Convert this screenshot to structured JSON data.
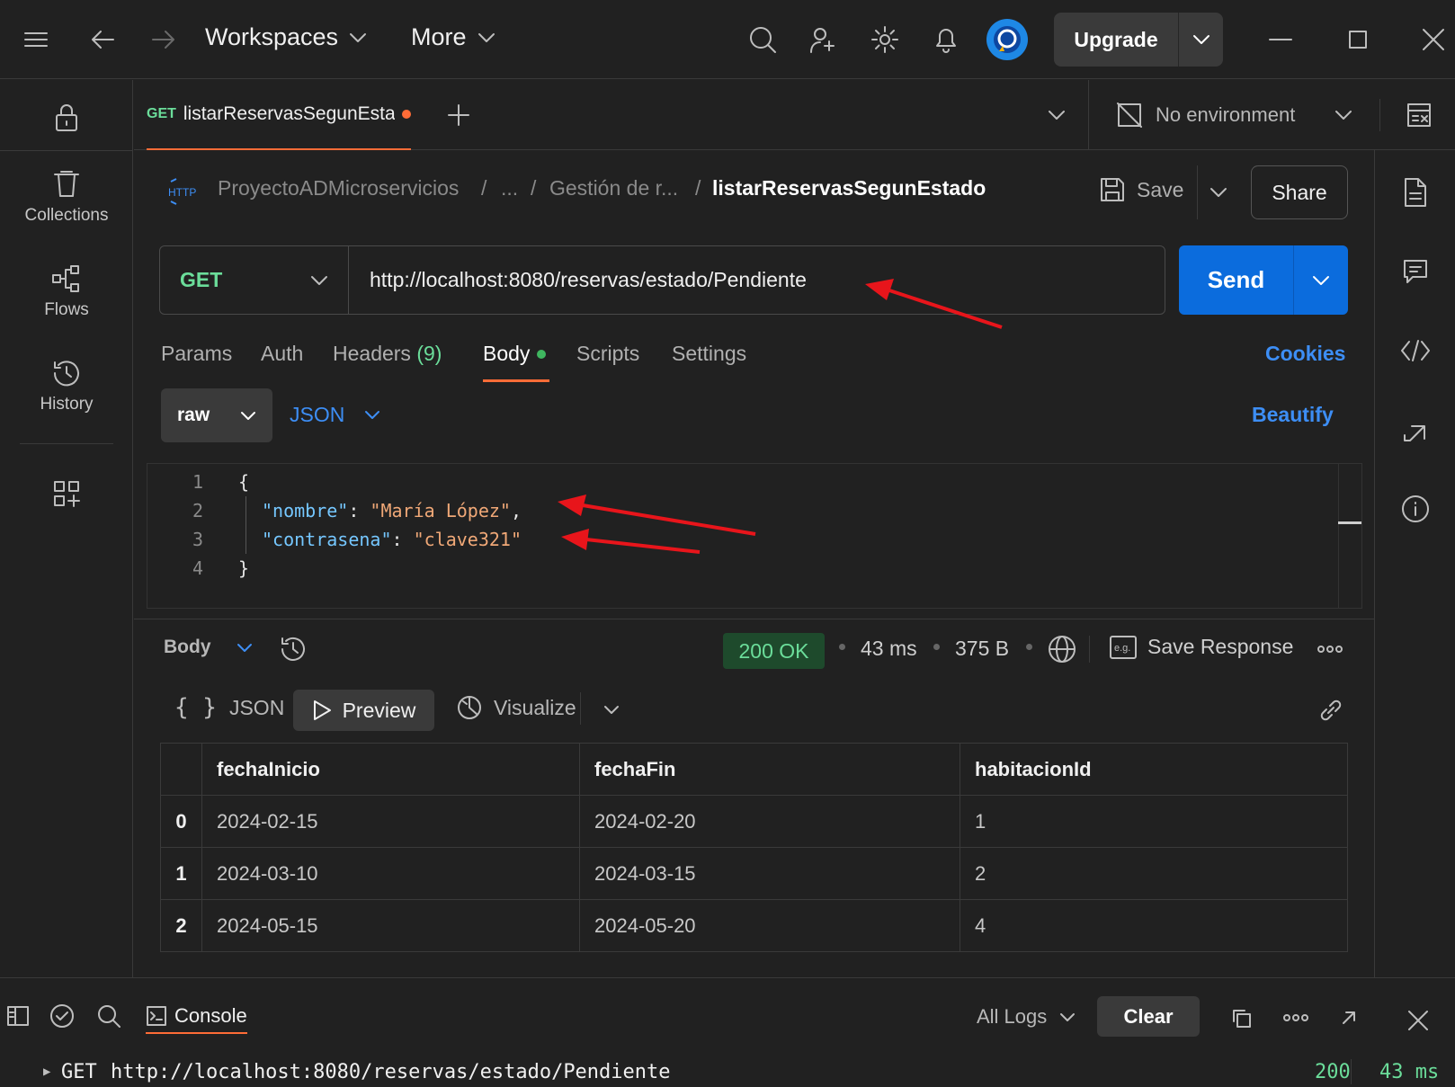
{
  "topbar": {
    "workspaces_label": "Workspaces",
    "more_label": "More",
    "upgrade_label": "Upgrade"
  },
  "sidebar": {
    "items": [
      {
        "label": "Collections",
        "icon": "trash-icon"
      },
      {
        "label": "Flows",
        "icon": "flows-icon"
      },
      {
        "label": "History",
        "icon": "history-icon"
      }
    ]
  },
  "tab": {
    "method": "GET",
    "name": "listarReservasSegunEstado",
    "environment": "No environment"
  },
  "breadcrumb": {
    "protocol": "HTTP",
    "collection": "ProyectoADMicroservicios",
    "sep": "/",
    "ellipsis": "...",
    "folder": "Gestión de r...",
    "request": "listarReservasSegunEstado"
  },
  "actions": {
    "save_label": "Save",
    "share_label": "Share"
  },
  "request": {
    "method": "GET",
    "url": "http://localhost:8080/reservas/estado/Pendiente",
    "send_label": "Send"
  },
  "request_tabs": {
    "params": "Params",
    "auth": "Auth",
    "headers": "Headers",
    "headers_count": "(9)",
    "body": "Body",
    "scripts": "Scripts",
    "settings": "Settings",
    "cookies": "Cookies"
  },
  "body_editor": {
    "mode": "raw",
    "language": "JSON",
    "beautify_label": "Beautify",
    "lines": [
      {
        "n": "1",
        "text": "{"
      },
      {
        "n": "2",
        "key": "\"nombre\"",
        "value": "\"María López\"",
        "tail": ","
      },
      {
        "n": "3",
        "key": "\"contrasena\"",
        "value": "\"clave321\"",
        "tail": ""
      },
      {
        "n": "4",
        "text": "}"
      }
    ]
  },
  "response": {
    "view_label": "Body",
    "status": "200 OK",
    "time": "43 ms",
    "size": "375 B",
    "save_response_label": "Save Response",
    "formats": {
      "json": "JSON",
      "preview": "Preview",
      "visualize": "Visualize"
    },
    "table": {
      "headers": [
        "fechaInicio",
        "fechaFin",
        "habitacionId"
      ],
      "rows": [
        {
          "idx": "0",
          "cells": [
            "2024-02-15",
            "2024-02-20",
            "1"
          ]
        },
        {
          "idx": "1",
          "cells": [
            "2024-03-10",
            "2024-03-15",
            "2"
          ]
        },
        {
          "idx": "2",
          "cells": [
            "2024-05-15",
            "2024-05-20",
            "4"
          ]
        }
      ]
    }
  },
  "console": {
    "tab_label": "Console",
    "filter_label": "All Logs",
    "clear_label": "Clear",
    "entry": {
      "method": "GET",
      "url": "http://localhost:8080/reservas/estado/Pendiente",
      "status": "200",
      "time": "43 ms"
    }
  },
  "colors": {
    "accent_orange": "#ff6c37",
    "send_blue": "#0b6cdd",
    "method_green": "#6bdd9a",
    "annotation_red": "#e8151b"
  }
}
